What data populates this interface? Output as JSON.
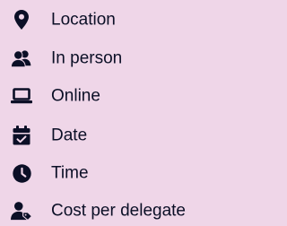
{
  "legend": {
    "items": [
      {
        "icon": "map-pin-icon",
        "label": "Location"
      },
      {
        "icon": "users-icon",
        "label": "In person"
      },
      {
        "icon": "laptop-icon",
        "label": "Online"
      },
      {
        "icon": "calendar-check-icon",
        "label": "Date"
      },
      {
        "icon": "clock-icon",
        "label": "Time"
      },
      {
        "icon": "user-tag-icon",
        "label": "Cost per delegate"
      }
    ]
  },
  "colors": {
    "background": "#efd6e8",
    "text": "#0b0f26",
    "icon": "#0b0f26"
  }
}
